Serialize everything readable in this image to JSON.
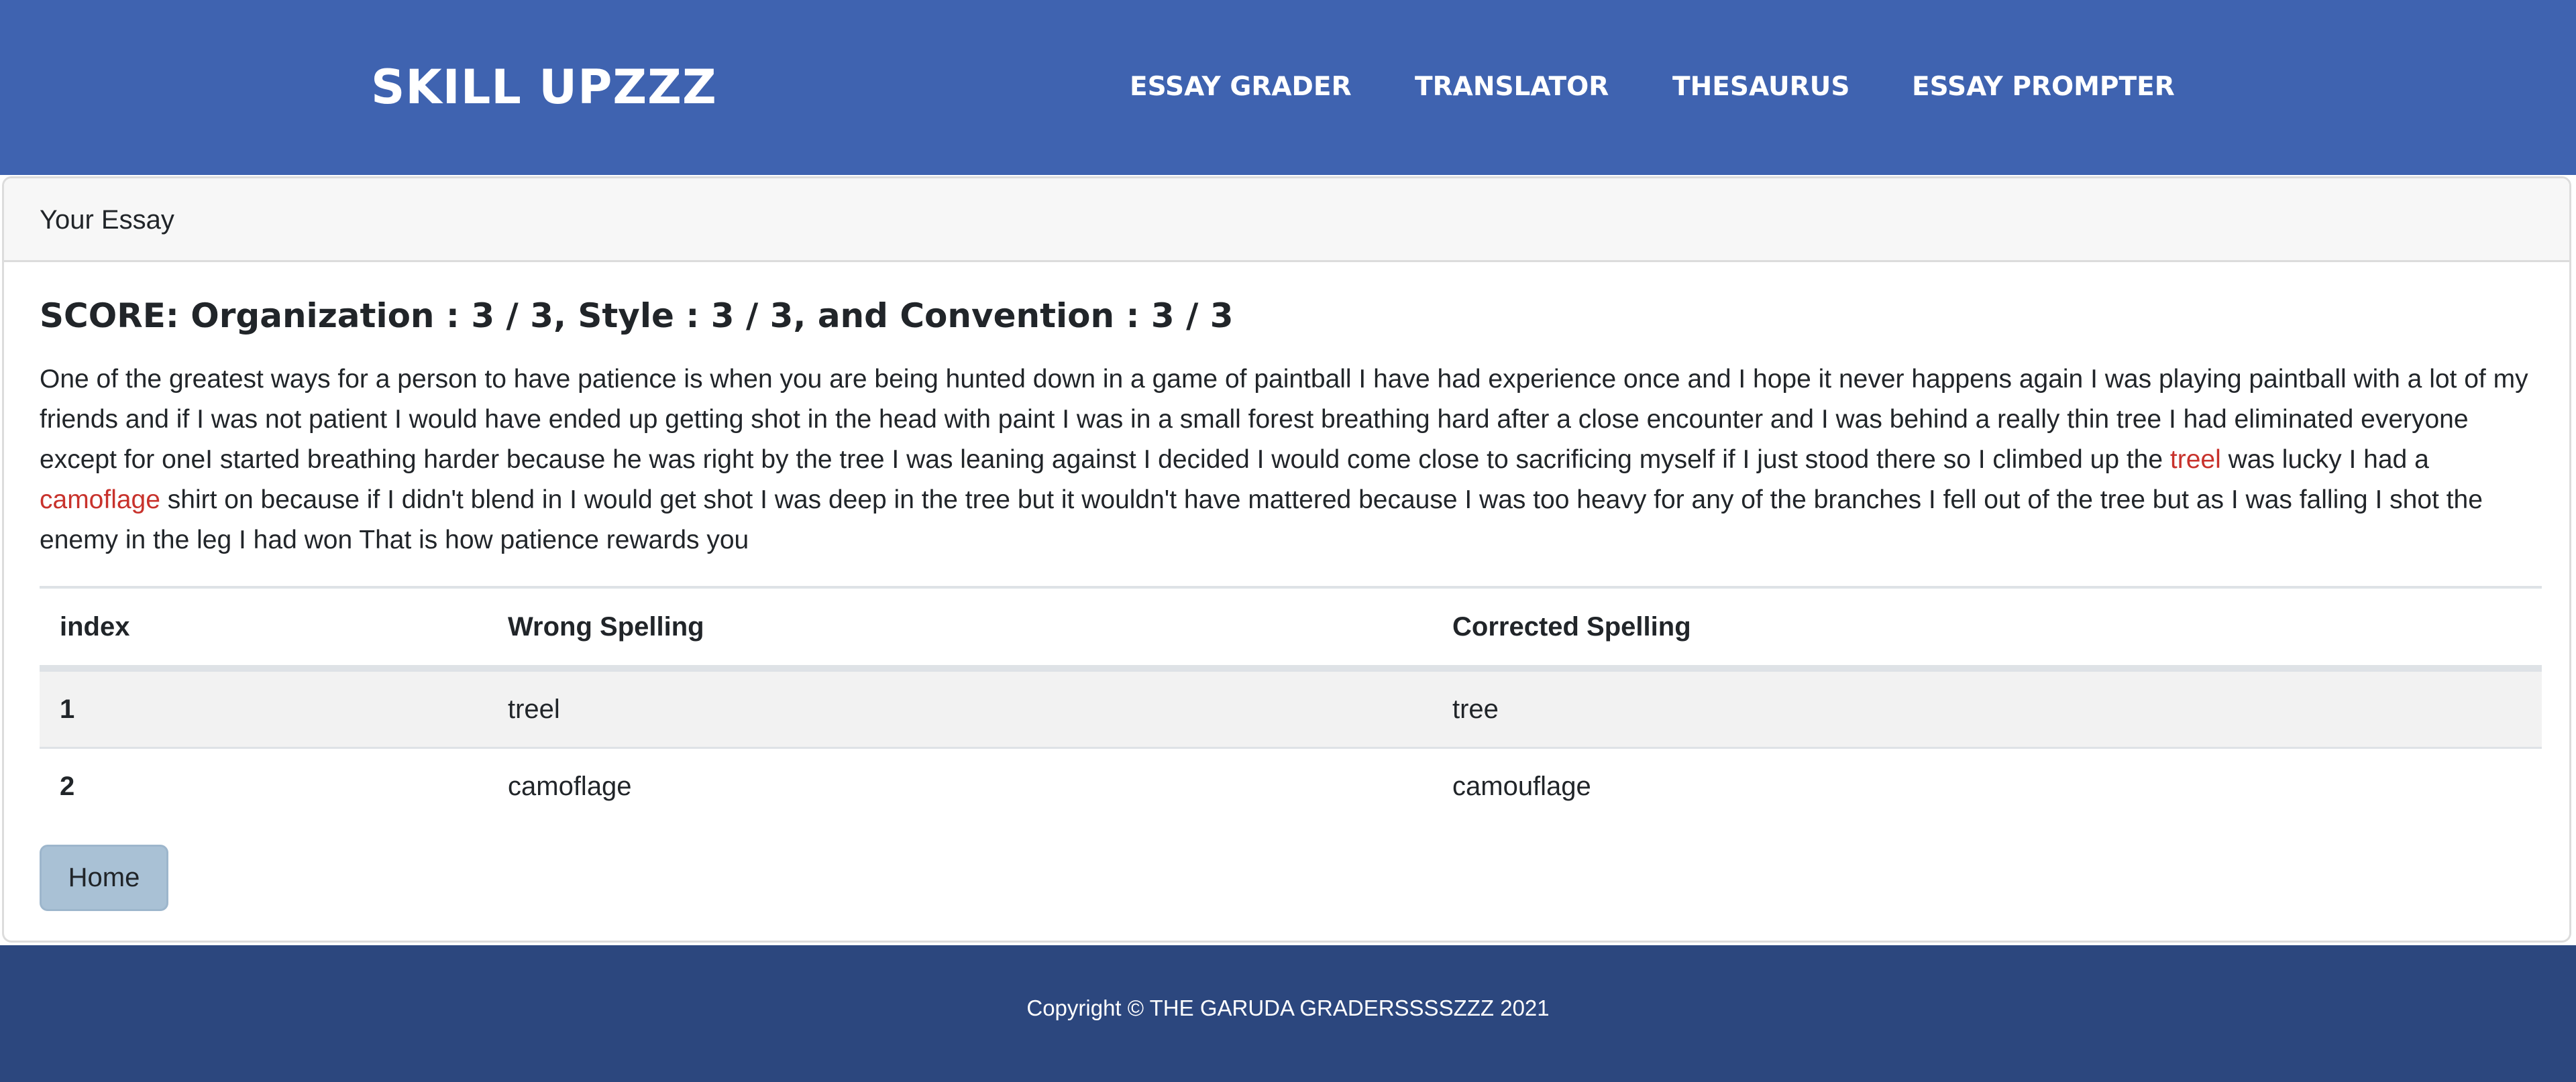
{
  "navbar": {
    "brand": "SKILL UPZZZ",
    "links": [
      "ESSAY GRADER",
      "TRANSLATOR",
      "THESAURUS",
      "ESSAY PROMPTER"
    ],
    "bg_color": "#3f63b0"
  },
  "card": {
    "header": "Your Essay",
    "score": "SCORE: Organization : 3 / 3, Style : 3 / 3, and Convention : 3 / 3",
    "essay": {
      "part1": "One of the greatest ways for a person to have patience is when you are being hunted down in a game of paintball I have had experience once and I hope it never happens again I was playing paintball with a lot of my friends and if I was not patient I would have ended up getting shot in the head with paint I was in a small forest breathing hard after a close encounter and I was behind a really thin tree I had eliminated everyone except for oneI started breathing harder because he was right by the tree I was leaning against I decided I would come close to sacrificing myself if I just stood there so I climbed up the ",
      "error1": "treel",
      "part2": " was lucky I had a ",
      "error2": "camoflage",
      "part3": " shirt on because if I didn't blend in I would get shot I was deep in the tree but it wouldn't have mattered because I was too heavy for any of the branches I fell out of the tree but as I was falling I shot the enemy in the leg I had won That is how patience rewards you",
      "error_color": "#c8322c"
    },
    "table": {
      "headers": [
        "index",
        "Wrong Spelling",
        "Corrected Spelling"
      ],
      "rows": [
        {
          "index": "1",
          "wrong": "treel",
          "corrected": "tree"
        },
        {
          "index": "2",
          "wrong": "camoflage",
          "corrected": "camouflage"
        }
      ]
    },
    "home_button": "Home"
  },
  "footer": {
    "text": "Copyright © THE GARUDA GRADERSSSSZZZ 2021",
    "bg_color": "#2c477e"
  }
}
